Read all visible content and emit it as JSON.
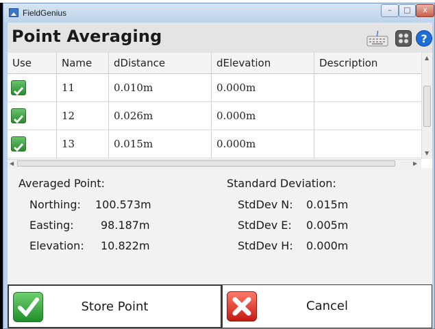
{
  "window": {
    "app_name": "FieldGenius",
    "controls": {
      "minimize": "–",
      "maximize": "□",
      "close": "x"
    }
  },
  "header": {
    "title": "Point Averaging",
    "icons": [
      "keyboard-icon",
      "apps-icon",
      "help-icon"
    ]
  },
  "table": {
    "columns": [
      "Use",
      "Name",
      "dDistance",
      "dElevation",
      "Description"
    ],
    "rows": [
      {
        "use": true,
        "name": "11",
        "ddistance": "0.010m",
        "delevation": "0.000m",
        "description": ""
      },
      {
        "use": true,
        "name": "12",
        "ddistance": "0.026m",
        "delevation": "0.000m",
        "description": ""
      },
      {
        "use": true,
        "name": "13",
        "ddistance": "0.015m",
        "delevation": "0.000m",
        "description": ""
      }
    ]
  },
  "averaged": {
    "heading": "Averaged Point:",
    "northing_label": "Northing:",
    "northing_value": "100.573m",
    "easting_label": "Easting:",
    "easting_value": "98.187m",
    "elevation_label": "Elevation:",
    "elevation_value": "10.822m"
  },
  "stddev": {
    "heading": "Standard Deviation:",
    "n_label": "StdDev N:",
    "n_value": "0.015m",
    "e_label": "StdDev E:",
    "e_value": "0.005m",
    "h_label": "StdDev H:",
    "h_value": "0.000m"
  },
  "actions": {
    "store_label": "Store Point",
    "cancel_label": "Cancel"
  },
  "colors": {
    "accent_green": "#2a8b2d",
    "cancel_red": "#c51a12",
    "header_bg": "#e4e4e4"
  }
}
